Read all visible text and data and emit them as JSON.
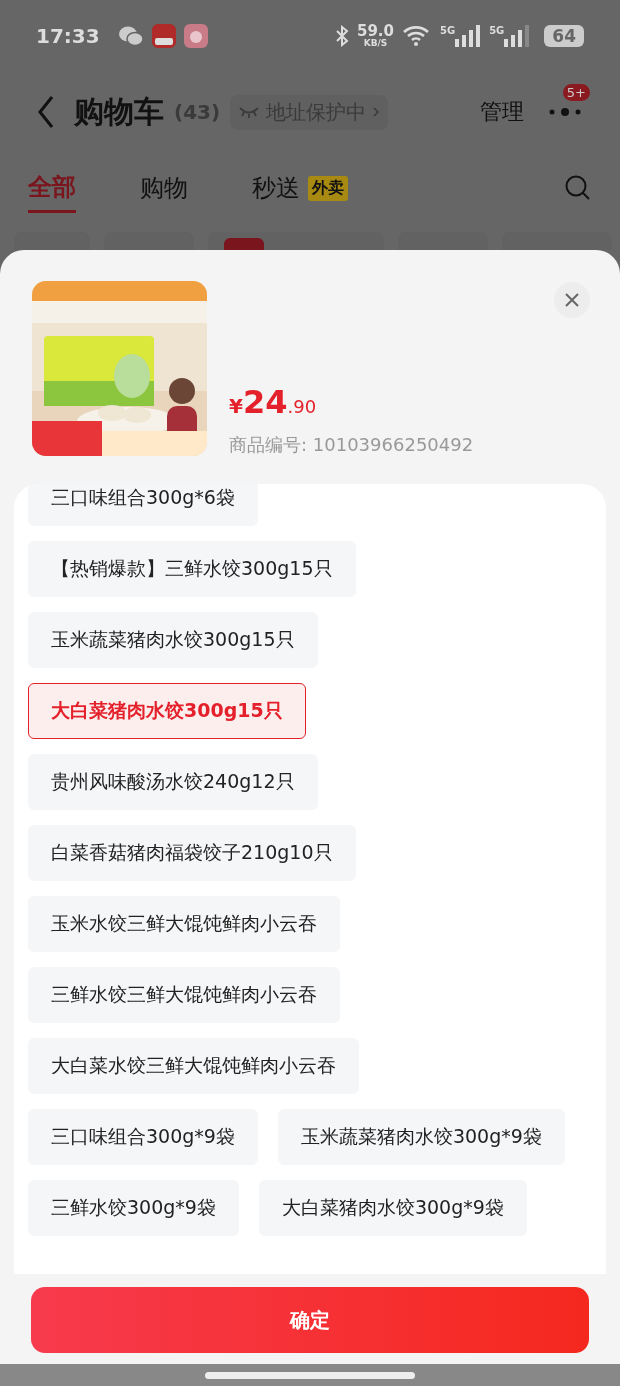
{
  "status_bar": {
    "time": "17:33",
    "speed": "59.0",
    "speed_unit": "KB/S",
    "network_1": "5G",
    "network_2": "5G",
    "battery": "64"
  },
  "header": {
    "title": "购物车",
    "count": "(43)",
    "address": "地址保护中",
    "manage": "管理",
    "badge": "5+"
  },
  "tabs": [
    {
      "label": "全部",
      "selected": true
    },
    {
      "label": "购物",
      "selected": false
    },
    {
      "label": "秒送",
      "selected": false,
      "tag": "外卖"
    }
  ],
  "product": {
    "price_symbol": "¥",
    "price_main": "24",
    "price_decimal": ".90",
    "code_label": "商品编号:",
    "code": "10103966250492"
  },
  "options": [
    {
      "label": "三口味组合300g*6袋",
      "selected": false
    },
    {
      "label": "【热销爆款】三鲜水饺300g15只",
      "selected": false
    },
    {
      "label": "玉米蔬菜猪肉水饺300g15只",
      "selected": false
    },
    {
      "label": "大白菜猪肉水饺300g15只",
      "selected": true
    },
    {
      "label": "贵州风味酸汤水饺240g12只",
      "selected": false
    },
    {
      "label": "白菜香菇猪肉福袋饺子210g10只",
      "selected": false
    },
    {
      "label": "玉米水饺三鲜大馄饨鲜肉小云吞",
      "selected": false
    },
    {
      "label": "三鲜水饺三鲜大馄饨鲜肉小云吞",
      "selected": false
    },
    {
      "label": "大白菜水饺三鲜大馄饨鲜肉小云吞",
      "selected": false
    },
    {
      "label": "三口味组合300g*9袋",
      "selected": false
    },
    {
      "label": "玉米蔬菜猪肉水饺300g*9袋",
      "selected": false
    },
    {
      "label": "三鲜水饺300g*9袋",
      "selected": false
    },
    {
      "label": "大白菜猪肉水饺300g*9袋",
      "selected": false
    }
  ],
  "confirm_button": "确定"
}
